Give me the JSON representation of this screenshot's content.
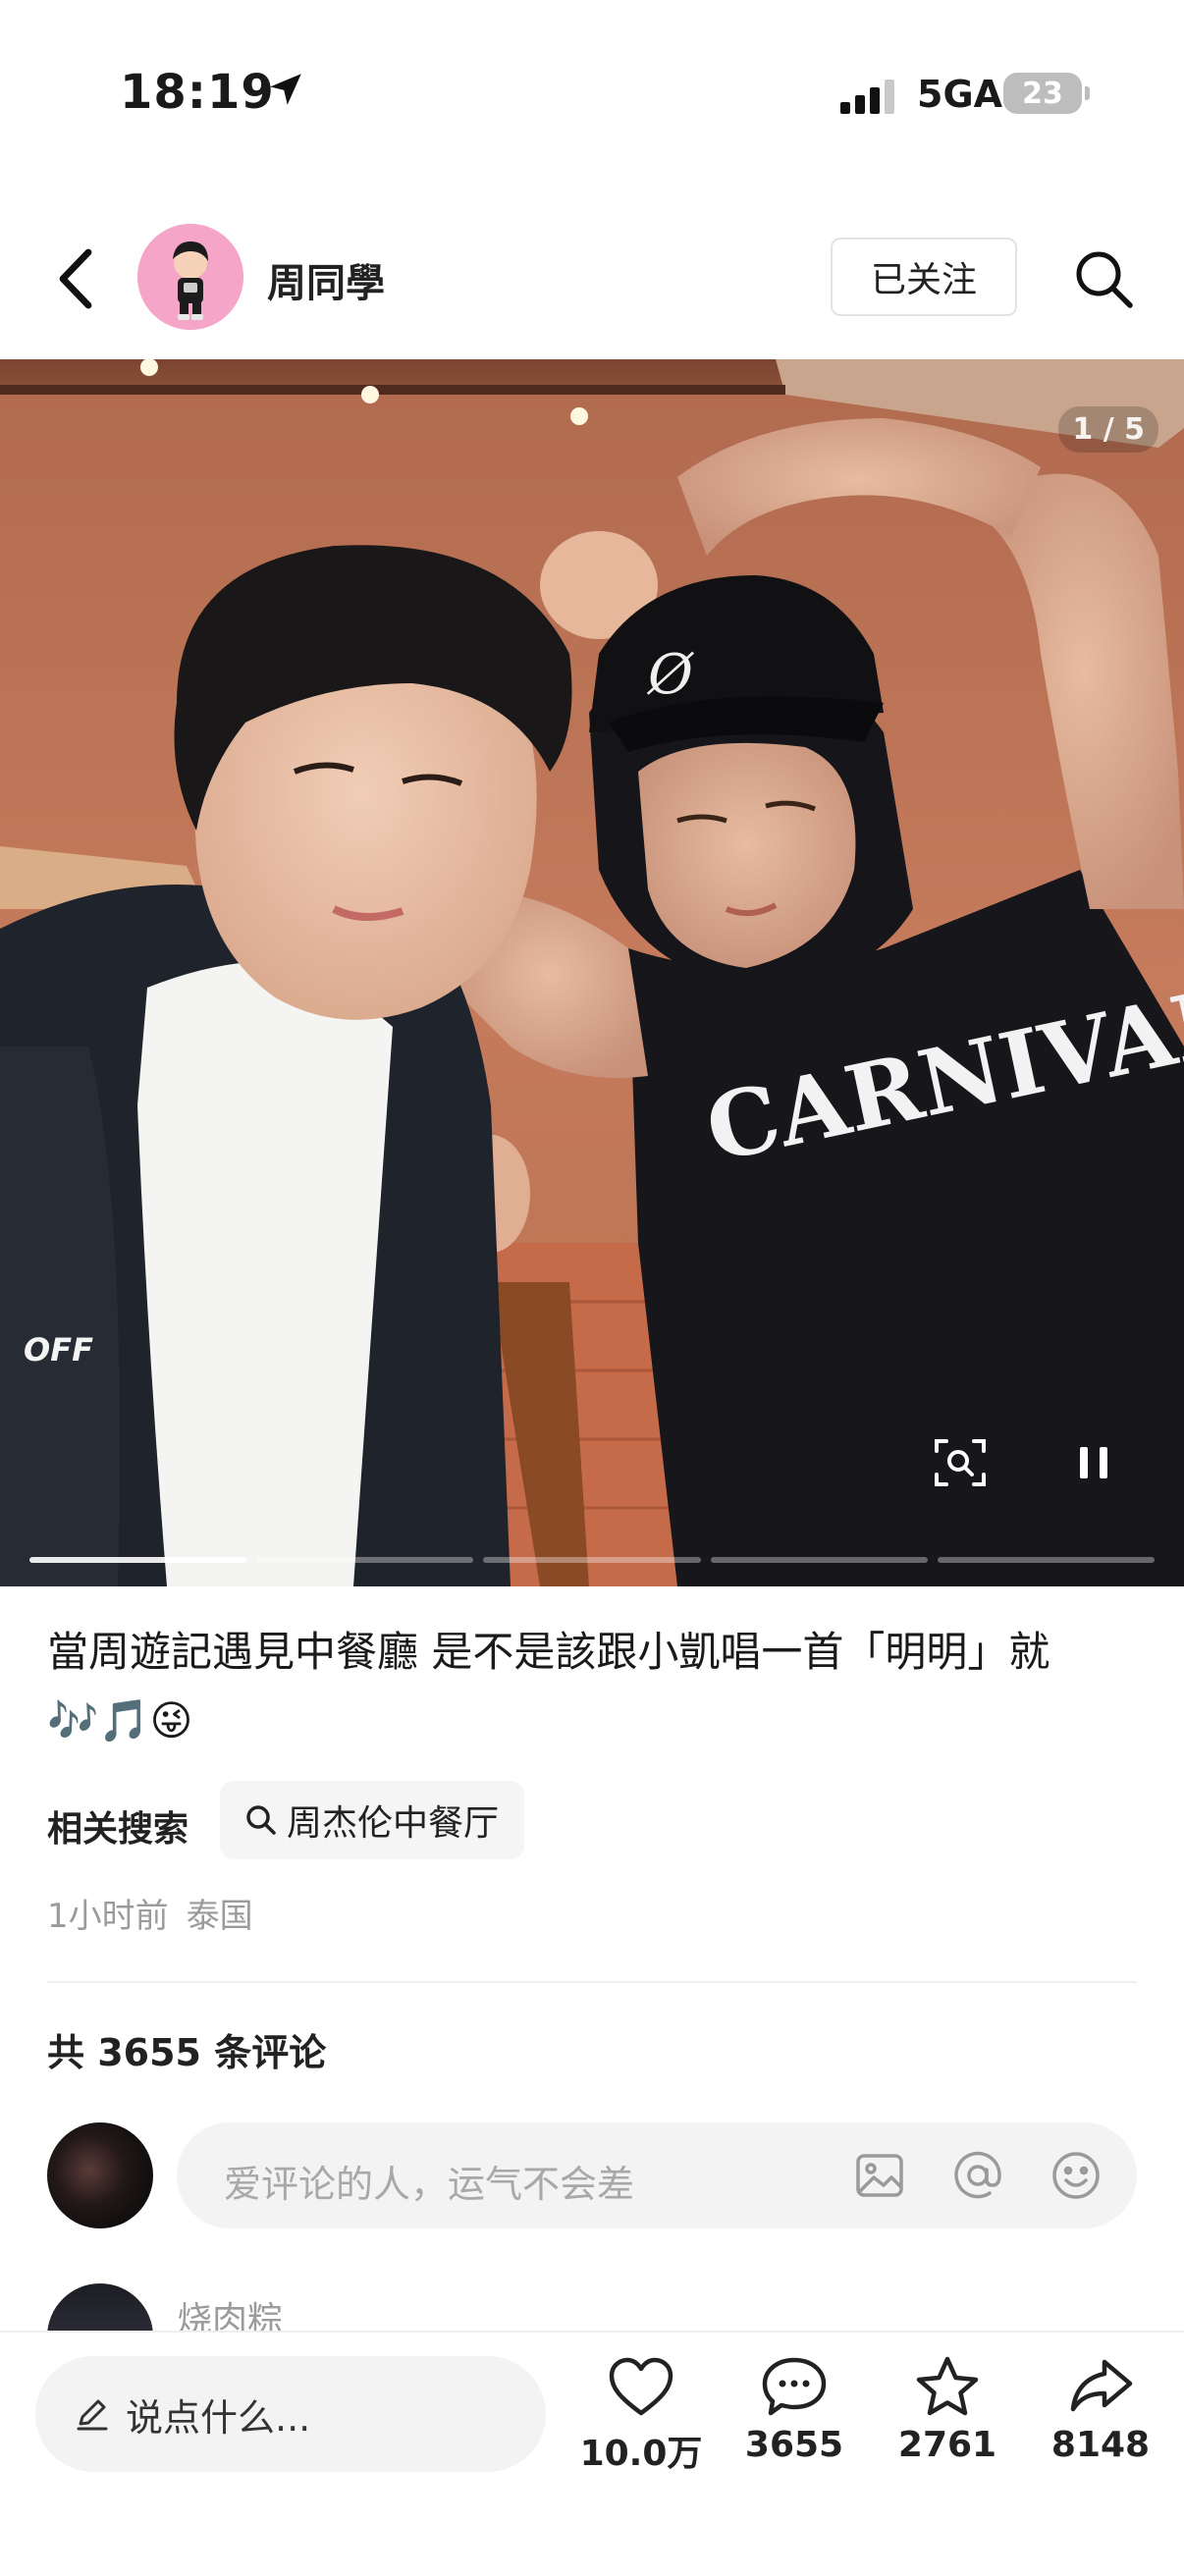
{
  "status_bar": {
    "time": "18:19",
    "network": "5GA",
    "battery": "23"
  },
  "header": {
    "author": "周同學",
    "follow_label": "已关注"
  },
  "carousel": {
    "page": "1 / 5",
    "total_pages": 5,
    "current_page": 1
  },
  "photo_text": {
    "jacket_print": "OFF"
  },
  "post": {
    "caption": "當周遊記遇見中餐廳 是不是該跟小凱唱一首「明明」就🎶🎵😜",
    "related_label": "相关搜索",
    "related_query": "周杰伦中餐厅",
    "time_ago": "1小时前",
    "location": "泰国"
  },
  "comments": {
    "title": "共 3655 条评论",
    "input_placeholder": "爱评论的人，运气不会差",
    "first_commenter": "烧肉粽"
  },
  "bottom_bar": {
    "say_placeholder": "说点什么...",
    "likes": "10.0万",
    "comments": "3655",
    "favorites": "2761",
    "shares": "8148"
  }
}
